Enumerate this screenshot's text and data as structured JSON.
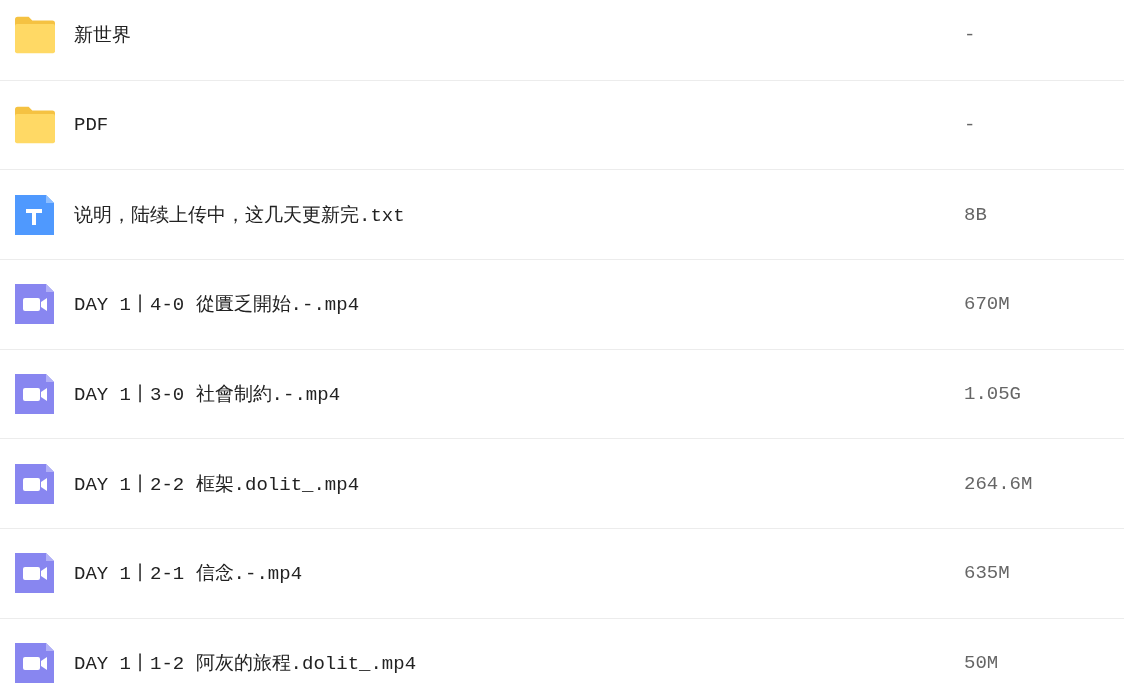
{
  "files": [
    {
      "kind": "folder",
      "name": "新世界",
      "size": "-"
    },
    {
      "kind": "folder",
      "name": "PDF",
      "size": "-"
    },
    {
      "kind": "text",
      "name": "说明，陆续上传中，这几天更新完.txt",
      "size": "8B"
    },
    {
      "kind": "video",
      "name": "DAY 1丨4-0 從匱乏開始.-.mp4",
      "size": "670M"
    },
    {
      "kind": "video",
      "name": "DAY 1丨3-0 社會制約.-.mp4",
      "size": "1.05G"
    },
    {
      "kind": "video",
      "name": "DAY 1丨2-2 框架.dolit_.mp4",
      "size": "264.6M"
    },
    {
      "kind": "video",
      "name": "DAY 1丨2-1 信念.-.mp4",
      "size": "635M"
    },
    {
      "kind": "video",
      "name": "DAY 1丨1-2 阿灰的旅程.dolit_.mp4",
      "size": "50M"
    }
  ]
}
